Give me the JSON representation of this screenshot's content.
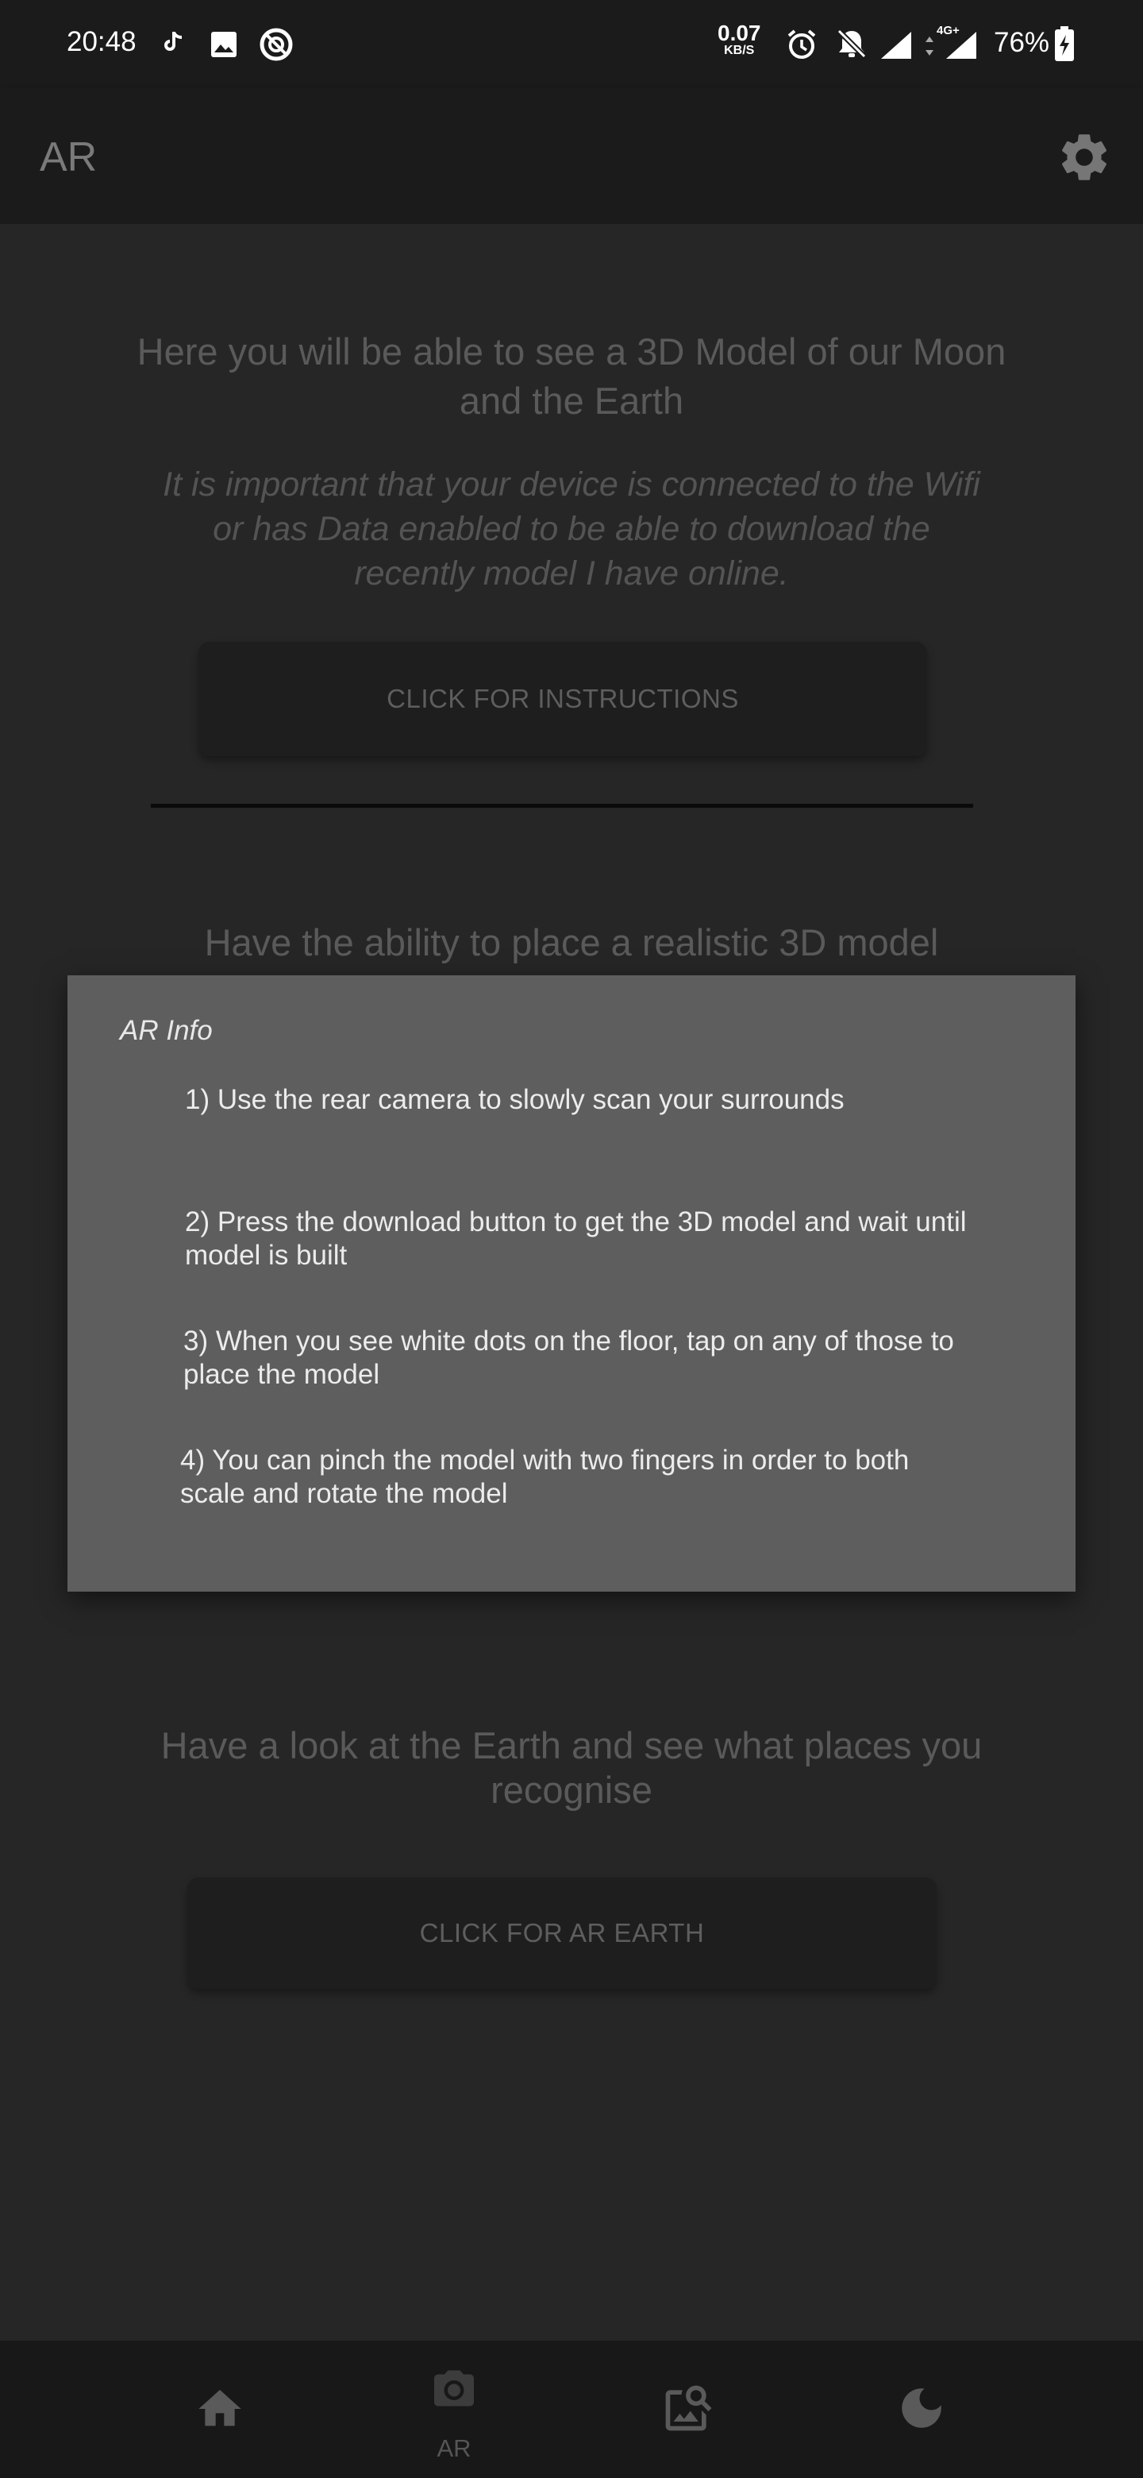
{
  "status_bar": {
    "time": "20:48",
    "net_speed_value": "0.07",
    "net_speed_unit": "KB/S",
    "network_type": "4G+",
    "battery": "76%"
  },
  "app_bar": {
    "title": "AR"
  },
  "main": {
    "intro_heading": "Here you will be able to see a 3D Model of our Moon and the Earth",
    "connection_note": "It is important that your device is connected to the Wifi or has Data enabled to be able to download the recently model I have online.",
    "instructions_button": "CLICK FOR INSTRUCTIONS",
    "place_model_heading": "Have the ability to place a realistic 3D model",
    "earth_heading": "Have a look at the Earth and see what places you recognise",
    "earth_button": "CLICK FOR AR EARTH"
  },
  "dialog": {
    "title": "AR Info",
    "steps": [
      "1) Use the rear camera to slowly scan your surrounds",
      "2) Press the download button to get the 3D model and wait until model is built",
      "3) When you see white dots on the floor, tap on any of those to place the model",
      "4) You can pinch the model with two fingers in order to both scale and rotate the model"
    ]
  },
  "bottom_nav": {
    "items": [
      {
        "icon": "home-icon",
        "label": ""
      },
      {
        "icon": "camera-icon",
        "label": "AR"
      },
      {
        "icon": "image-search-icon",
        "label": ""
      },
      {
        "icon": "moon-icon",
        "label": ""
      }
    ]
  }
}
